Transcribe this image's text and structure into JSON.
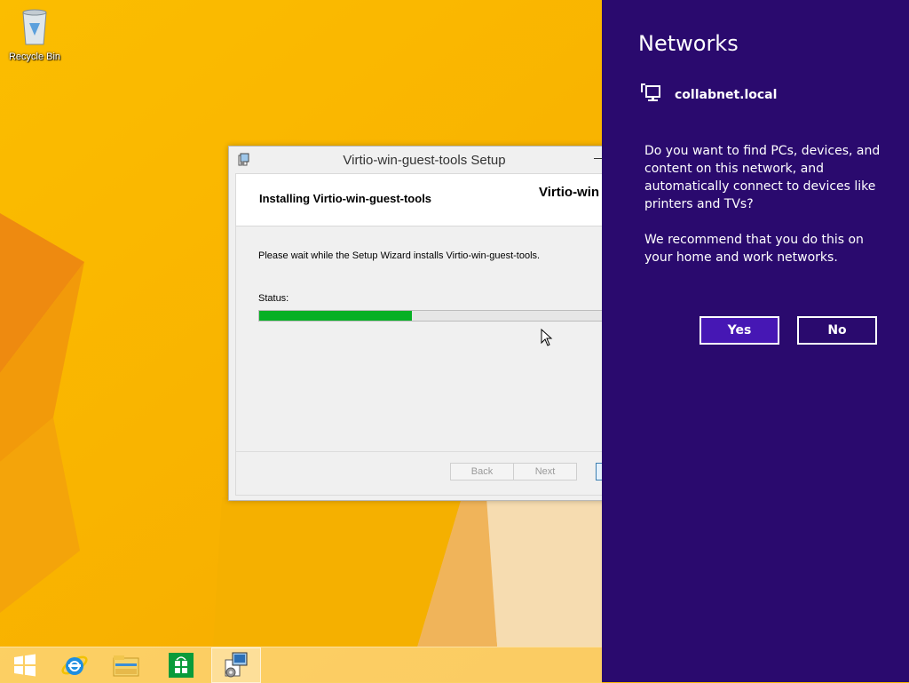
{
  "desktop": {
    "recycle_bin_label": "Recycle Bin"
  },
  "setup_window": {
    "title": "Virtio-win-guest-tools Setup",
    "header_title": "Installing Virtio-win-guest-tools",
    "brand_text": "Virtio-win",
    "body_text": "Please wait while the Setup Wizard installs Virtio-win-guest-tools.",
    "status_label": "Status:",
    "progress_fraction": 0.43,
    "back_label": "Back",
    "next_label": "Next"
  },
  "networks_pane": {
    "title": "Networks",
    "network_name": "collabnet.local",
    "question": "Do you want to find PCs, devices, and content on this network, and automatically connect to devices like printers and TVs?",
    "recommendation": "We recommend that you do this on your home and work networks.",
    "yes_label": "Yes",
    "no_label": "No"
  },
  "taskbar": {
    "items": [
      "start-icon",
      "internet-explorer-icon",
      "file-explorer-icon",
      "store-icon",
      "setup-installer-icon"
    ]
  },
  "colors": {
    "charm_background": "#2a0a6e",
    "yes_button": "#4617b4",
    "progress_fill": "#06b025",
    "wallpaper": "#f7b500"
  }
}
